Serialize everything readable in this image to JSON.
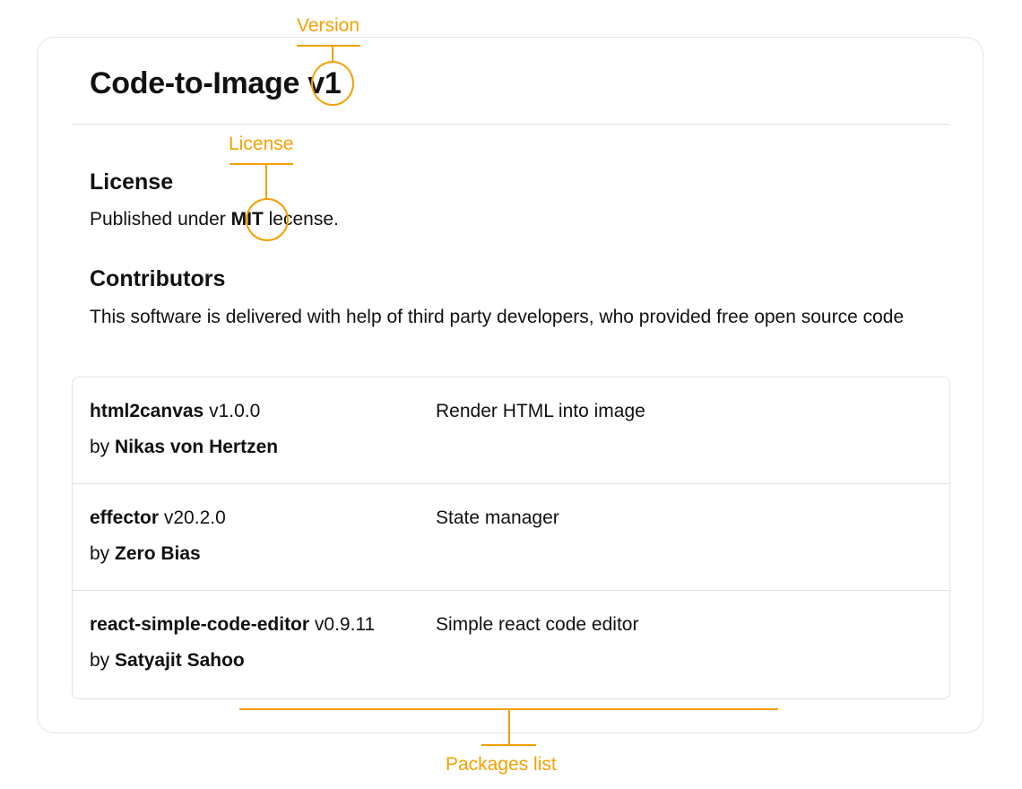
{
  "header": {
    "title": "Code-to-Image",
    "version": "v1"
  },
  "license": {
    "heading": "License",
    "text_before": "Published under",
    "name": "MIT",
    "text_after": "lecense."
  },
  "contributors": {
    "heading": "Contributors",
    "description": "This software is delivered with help of third party developers, who provided free open source code"
  },
  "packages": [
    {
      "name": "html2canvas",
      "version": "v1.0.0",
      "by": "by",
      "author": "Nikas von Hertzen",
      "description": "Render HTML into image"
    },
    {
      "name": "effector",
      "version": "v20.2.0",
      "by": "by",
      "author": "Zero Bias",
      "description": "State manager"
    },
    {
      "name": "react-simple-code-editor",
      "version": "v0.9.11",
      "by": "by",
      "author": "Satyajit Sahoo",
      "description": "Simple react code editor"
    }
  ],
  "annotations": {
    "version_label": "Version",
    "license_label": "License",
    "packages_label": "Packages list",
    "accent_color": "#f5a000"
  }
}
